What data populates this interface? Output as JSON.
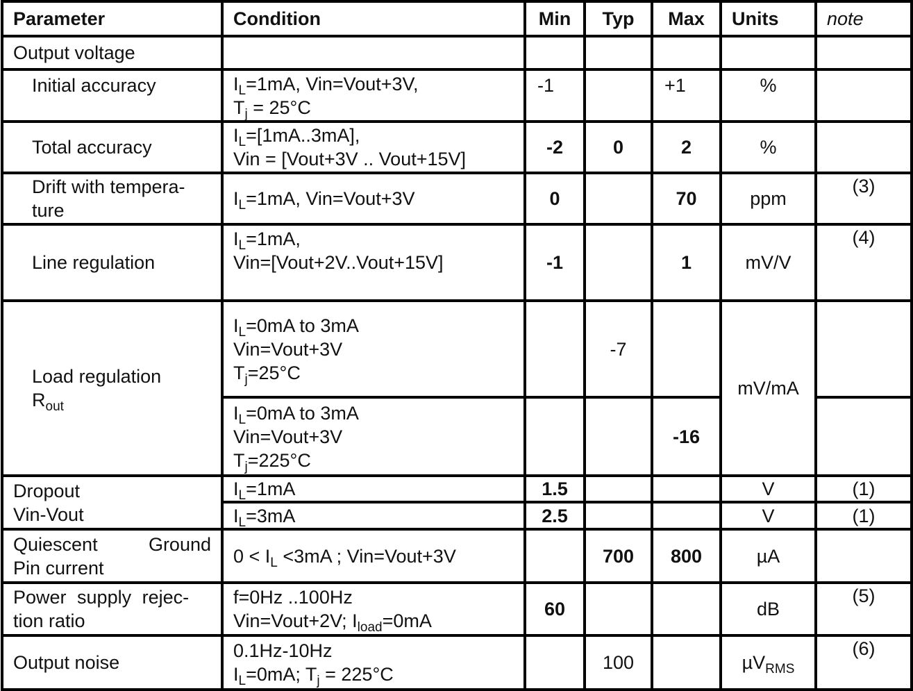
{
  "headers": {
    "parameter": "Parameter",
    "condition": "Condition",
    "min": "Min",
    "typ": "Typ",
    "max": "Max",
    "units": "Units",
    "note": "note"
  },
  "rows": {
    "output_voltage": {
      "parameter": "Output voltage"
    },
    "initial_accuracy": {
      "parameter": "Initial accuracy",
      "cond_l1_pre": "I",
      "cond_l1_sub": "L",
      "cond_l1_post": "=1mA, Vin=Vout+3V,",
      "cond_l2_pre": "T",
      "cond_l2_sub": "j",
      "cond_l2_post": " = 25°C",
      "min": "-1",
      "typ": "",
      "max": "+1",
      "units": "%",
      "note": ""
    },
    "total_accuracy": {
      "parameter": "Total accuracy",
      "cond_l1_pre": "I",
      "cond_l1_sub": "L",
      "cond_l1_post": "=[1mA..3mA],",
      "cond_l2": "Vin = [Vout+3V .. Vout+15V]",
      "min": "-2",
      "typ": "0",
      "max": "2",
      "units": "%",
      "note": ""
    },
    "drift": {
      "parameter_l1": "Drift with tempera-",
      "parameter_l2": "ture",
      "cond_pre": "I",
      "cond_sub": "L",
      "cond_post": "=1mA, Vin=Vout+3V",
      "min": "0",
      "typ": "",
      "max": "70",
      "units": "ppm",
      "note": "(3)"
    },
    "line_regulation": {
      "parameter": "Line regulation",
      "cond_l1_pre": "I",
      "cond_l1_sub": "L",
      "cond_l1_post": "=1mA,",
      "cond_l2": "Vin=[Vout+2V..Vout+15V]",
      "min": "-1",
      "typ": "",
      "max": "1",
      "units": "mV/V",
      "note": "(4)"
    },
    "load_regulation": {
      "parameter_l1": "Load regulation",
      "parameter_l2_pre": "R",
      "parameter_l2_sub": "out",
      "units": "mV/mA",
      "sub_rows": [
        {
          "cond_l1_pre": "I",
          "cond_l1_sub": "L",
          "cond_l1_post": "=0mA to 3mA",
          "cond_l2": "Vin=Vout+3V",
          "cond_l3_pre": "T",
          "cond_l3_sub": "j",
          "cond_l3_post": "=25°C",
          "min": "",
          "typ": "-7",
          "max": "",
          "note": ""
        },
        {
          "cond_l1_pre": "I",
          "cond_l1_sub": "L",
          "cond_l1_post": "=0mA to 3mA",
          "cond_l2": "Vin=Vout+3V",
          "cond_l3_pre": "T",
          "cond_l3_sub": "j",
          "cond_l3_post": "=225°C",
          "min": "",
          "typ": "",
          "max": "-16",
          "note": ""
        }
      ]
    },
    "dropout": {
      "parameter_l1": "Dropout",
      "parameter_l2": "Vin-Vout",
      "sub_rows": [
        {
          "cond_pre": "I",
          "cond_sub": "L",
          "cond_post": "=1mA",
          "min": "1.5",
          "typ": "",
          "max": "",
          "units": "V",
          "note": "(1)"
        },
        {
          "cond_pre": "I",
          "cond_sub": "L",
          "cond_post": "=3mA",
          "min": "2.5",
          "typ": "",
          "max": "",
          "units": "V",
          "note": "(1)"
        }
      ]
    },
    "quiescent": {
      "parameter_l1a": "Quiescent",
      "parameter_l1b": "Ground",
      "parameter_l2": "Pin current",
      "cond_pre": "0 < I",
      "cond_sub": "L",
      "cond_post": " <3mA ; Vin=Vout+3V",
      "min": "",
      "typ": "700",
      "max": "800",
      "units": "µA",
      "note": ""
    },
    "psrr": {
      "parameter_l1": "Power supply rejec-",
      "parameter_l2": "tion ratio",
      "cond_l1": "f=0Hz ..100Hz",
      "cond_l2_pre": "Vin=Vout+2V; I",
      "cond_l2_sub": "load",
      "cond_l2_post": "=0mA",
      "min": "60",
      "typ": "",
      "max": "",
      "units": "dB",
      "note": "(5)"
    },
    "output_noise": {
      "parameter": "Output noise",
      "cond_l1": "0.1Hz-10Hz",
      "cond_l2_pre": "I",
      "cond_l2_sub": "L",
      "cond_l2_mid": "=0mA; T",
      "cond_l2_sub2": "j",
      "cond_l2_post": " = 225°C",
      "min": "",
      "typ": "100",
      "max": "",
      "units_pre": "µV",
      "units_sub": "RMS",
      "note": "(6)"
    }
  }
}
